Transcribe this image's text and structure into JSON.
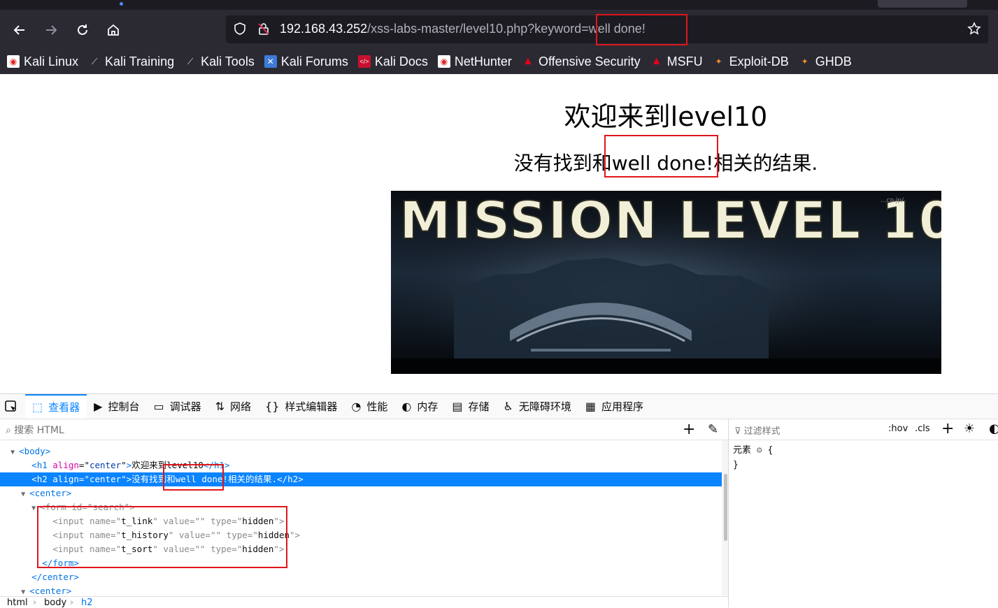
{
  "browser": {
    "url_host": "192.168.43.252",
    "url_path": "/xss-labs-master/level10.php?keyword=well done!",
    "bookmarks": [
      {
        "label": "Kali Linux",
        "icon": "kali-icon"
      },
      {
        "label": "Kali Training",
        "icon": "kali-dragon-icon"
      },
      {
        "label": "Kali Tools",
        "icon": "kali-dragon-icon"
      },
      {
        "label": "Kali Forums",
        "icon": "kali-forums-icon"
      },
      {
        "label": "Kali Docs",
        "icon": "kali-docs-icon"
      },
      {
        "label": "NetHunter",
        "icon": "kali-icon"
      },
      {
        "label": "Offensive Security",
        "icon": "offsec-icon"
      },
      {
        "label": "MSFU",
        "icon": "offsec-icon"
      },
      {
        "label": "Exploit-DB",
        "icon": "exploitdb-icon"
      },
      {
        "label": "GHDB",
        "icon": "exploitdb-icon"
      }
    ]
  },
  "page": {
    "h1": "欢迎来到level10",
    "h2": "没有找到和well done!相关的结果.",
    "banner": {
      "title": "MISSION LEVEL 10",
      "corner_text": "...co.jp/"
    }
  },
  "devtools": {
    "tabs": [
      {
        "label": "查看器",
        "icon": "inspector-icon",
        "active": true
      },
      {
        "label": "控制台",
        "icon": "console-icon"
      },
      {
        "label": "调试器",
        "icon": "debugger-icon"
      },
      {
        "label": "网络",
        "icon": "network-icon"
      },
      {
        "label": "样式编辑器",
        "icon": "style-editor-icon"
      },
      {
        "label": "性能",
        "icon": "performance-icon"
      },
      {
        "label": "内存",
        "icon": "memory-icon"
      },
      {
        "label": "存储",
        "icon": "storage-icon"
      },
      {
        "label": "无障碍环境",
        "icon": "accessibility-icon"
      },
      {
        "label": "应用程序",
        "icon": "application-icon"
      }
    ],
    "search_placeholder": "搜索 HTML",
    "filter_placeholder": "过滤样式",
    "hov_label": ":hov",
    "cls_label": ".cls",
    "rules_element": "元素",
    "rules_open": "{",
    "rules_close": "}",
    "tree": {
      "body_open": "body",
      "h1": {
        "tag": "h1",
        "attr": "align",
        "val": "center",
        "text": "欢迎来到level10"
      },
      "h2": {
        "tag": "h2",
        "attr": "align",
        "val": "center",
        "text": "没有找到和well done!相关的结果."
      },
      "center_open": "center",
      "form": {
        "tag": "form",
        "attr": "id",
        "val": "search"
      },
      "inputs": [
        {
          "name": "t_link",
          "value": "",
          "type": "hidden"
        },
        {
          "name": "t_history",
          "value": "",
          "type": "hidden"
        },
        {
          "name": "t_sort",
          "value": "",
          "type": "hidden"
        }
      ],
      "form_close": "form",
      "center_close": "center",
      "center_next": "center"
    },
    "breadcrumbs": [
      "html",
      "body",
      "h2"
    ]
  }
}
